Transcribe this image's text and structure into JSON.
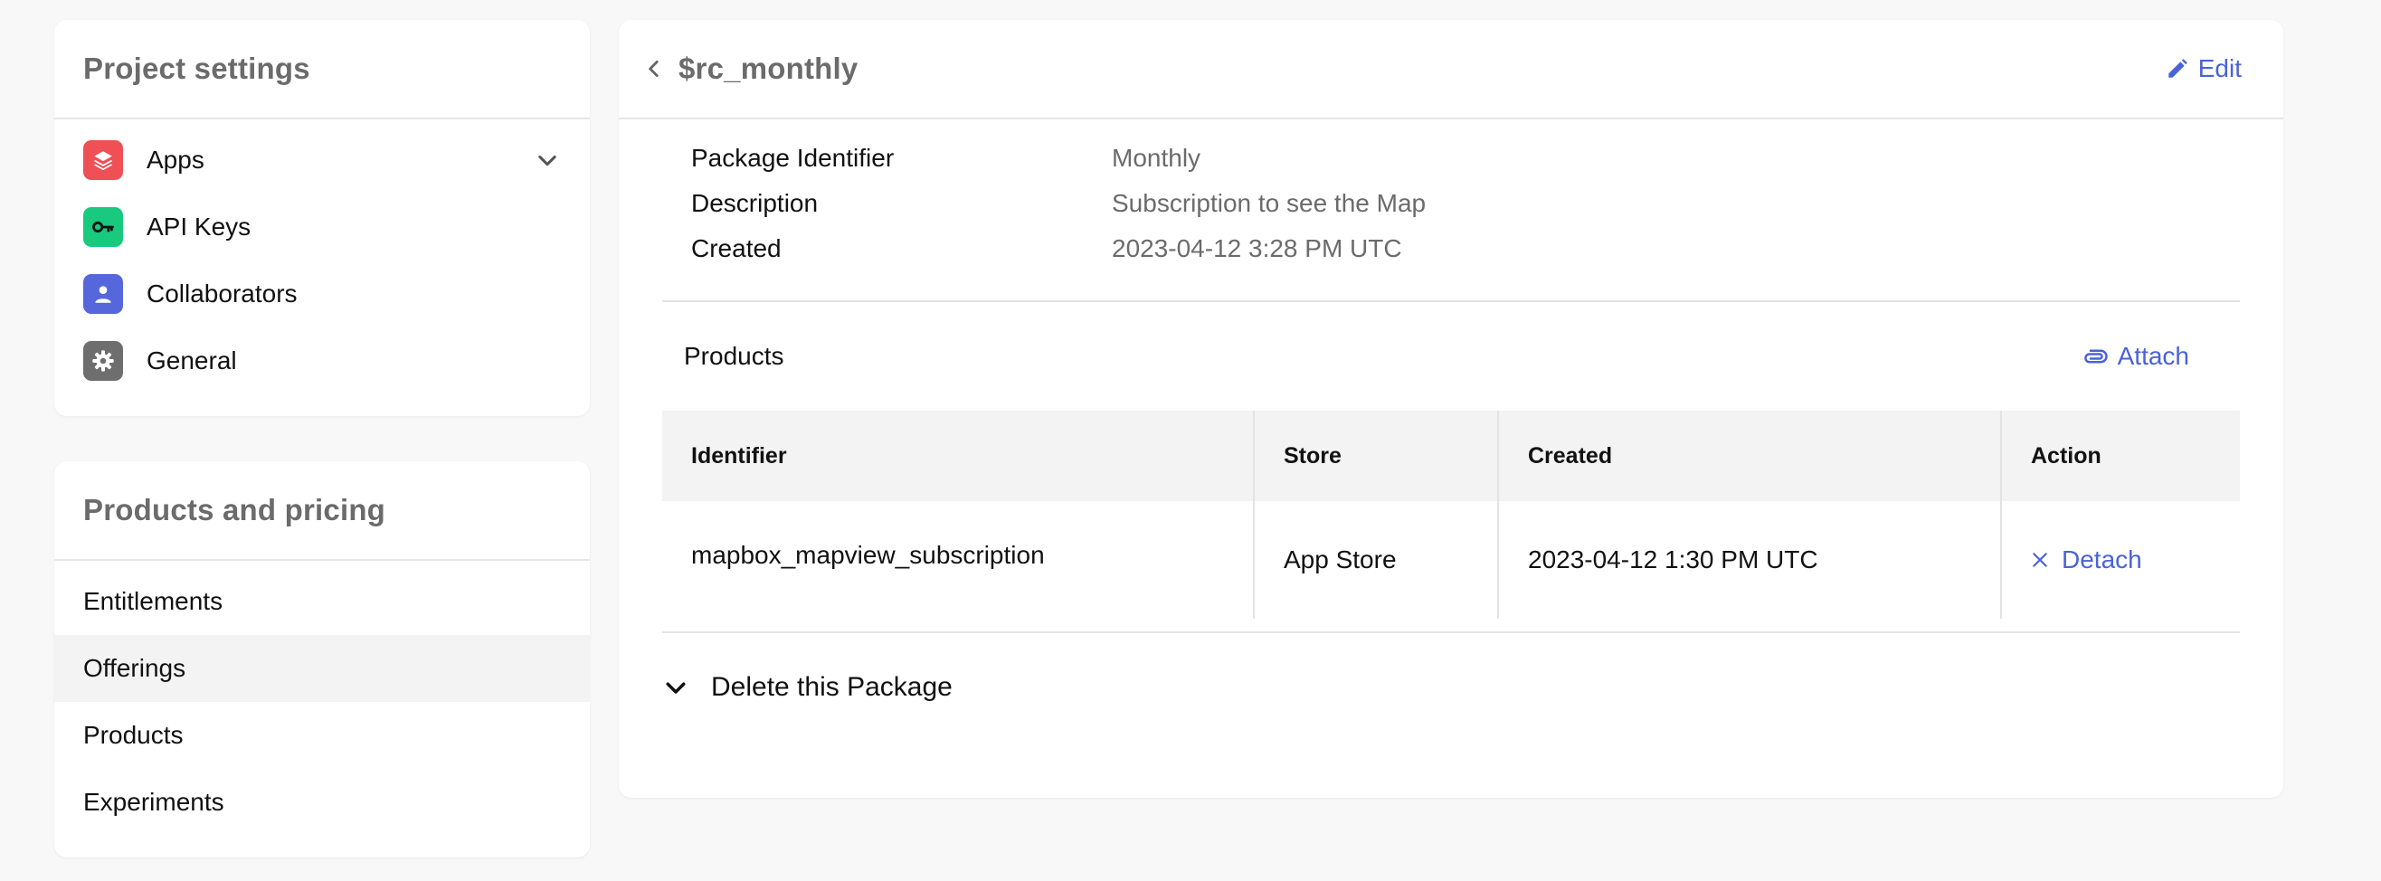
{
  "sidebar": {
    "project_settings": {
      "title": "Project settings",
      "items": [
        {
          "label": "Apps",
          "icon": "apps-stack-icon",
          "color": "#ef4f55"
        },
        {
          "label": "API Keys",
          "icon": "key-icon",
          "color": "#19c97e"
        },
        {
          "label": "Collaborators",
          "icon": "person-icon",
          "color": "#5667dc"
        },
        {
          "label": "General",
          "icon": "gear-icon",
          "color": "#6e6e6e"
        }
      ]
    },
    "products_pricing": {
      "title": "Products and pricing",
      "items": [
        {
          "label": "Entitlements"
        },
        {
          "label": "Offerings",
          "selected": true
        },
        {
          "label": "Products"
        },
        {
          "label": "Experiments"
        }
      ]
    }
  },
  "package": {
    "title": "$rc_monthly",
    "edit_label": "Edit",
    "details": [
      {
        "key": "Package Identifier",
        "value": "Monthly"
      },
      {
        "key": "Description",
        "value": "Subscription to see the Map"
      },
      {
        "key": "Created",
        "value": "2023-04-12 3:28 PM UTC"
      }
    ]
  },
  "products": {
    "title": "Products",
    "attach_label": "Attach",
    "columns": [
      "Identifier",
      "Store",
      "Created",
      "Action"
    ],
    "rows": [
      {
        "identifier": "mapbox_mapview_subscription",
        "store": "App Store",
        "created": "2023-04-12 1:30 PM UTC",
        "action": "Detach"
      }
    ]
  },
  "delete_section": {
    "label": "Delete this Package"
  },
  "colors": {
    "accent": "#4a62d8",
    "background": "#f8f8f8"
  }
}
